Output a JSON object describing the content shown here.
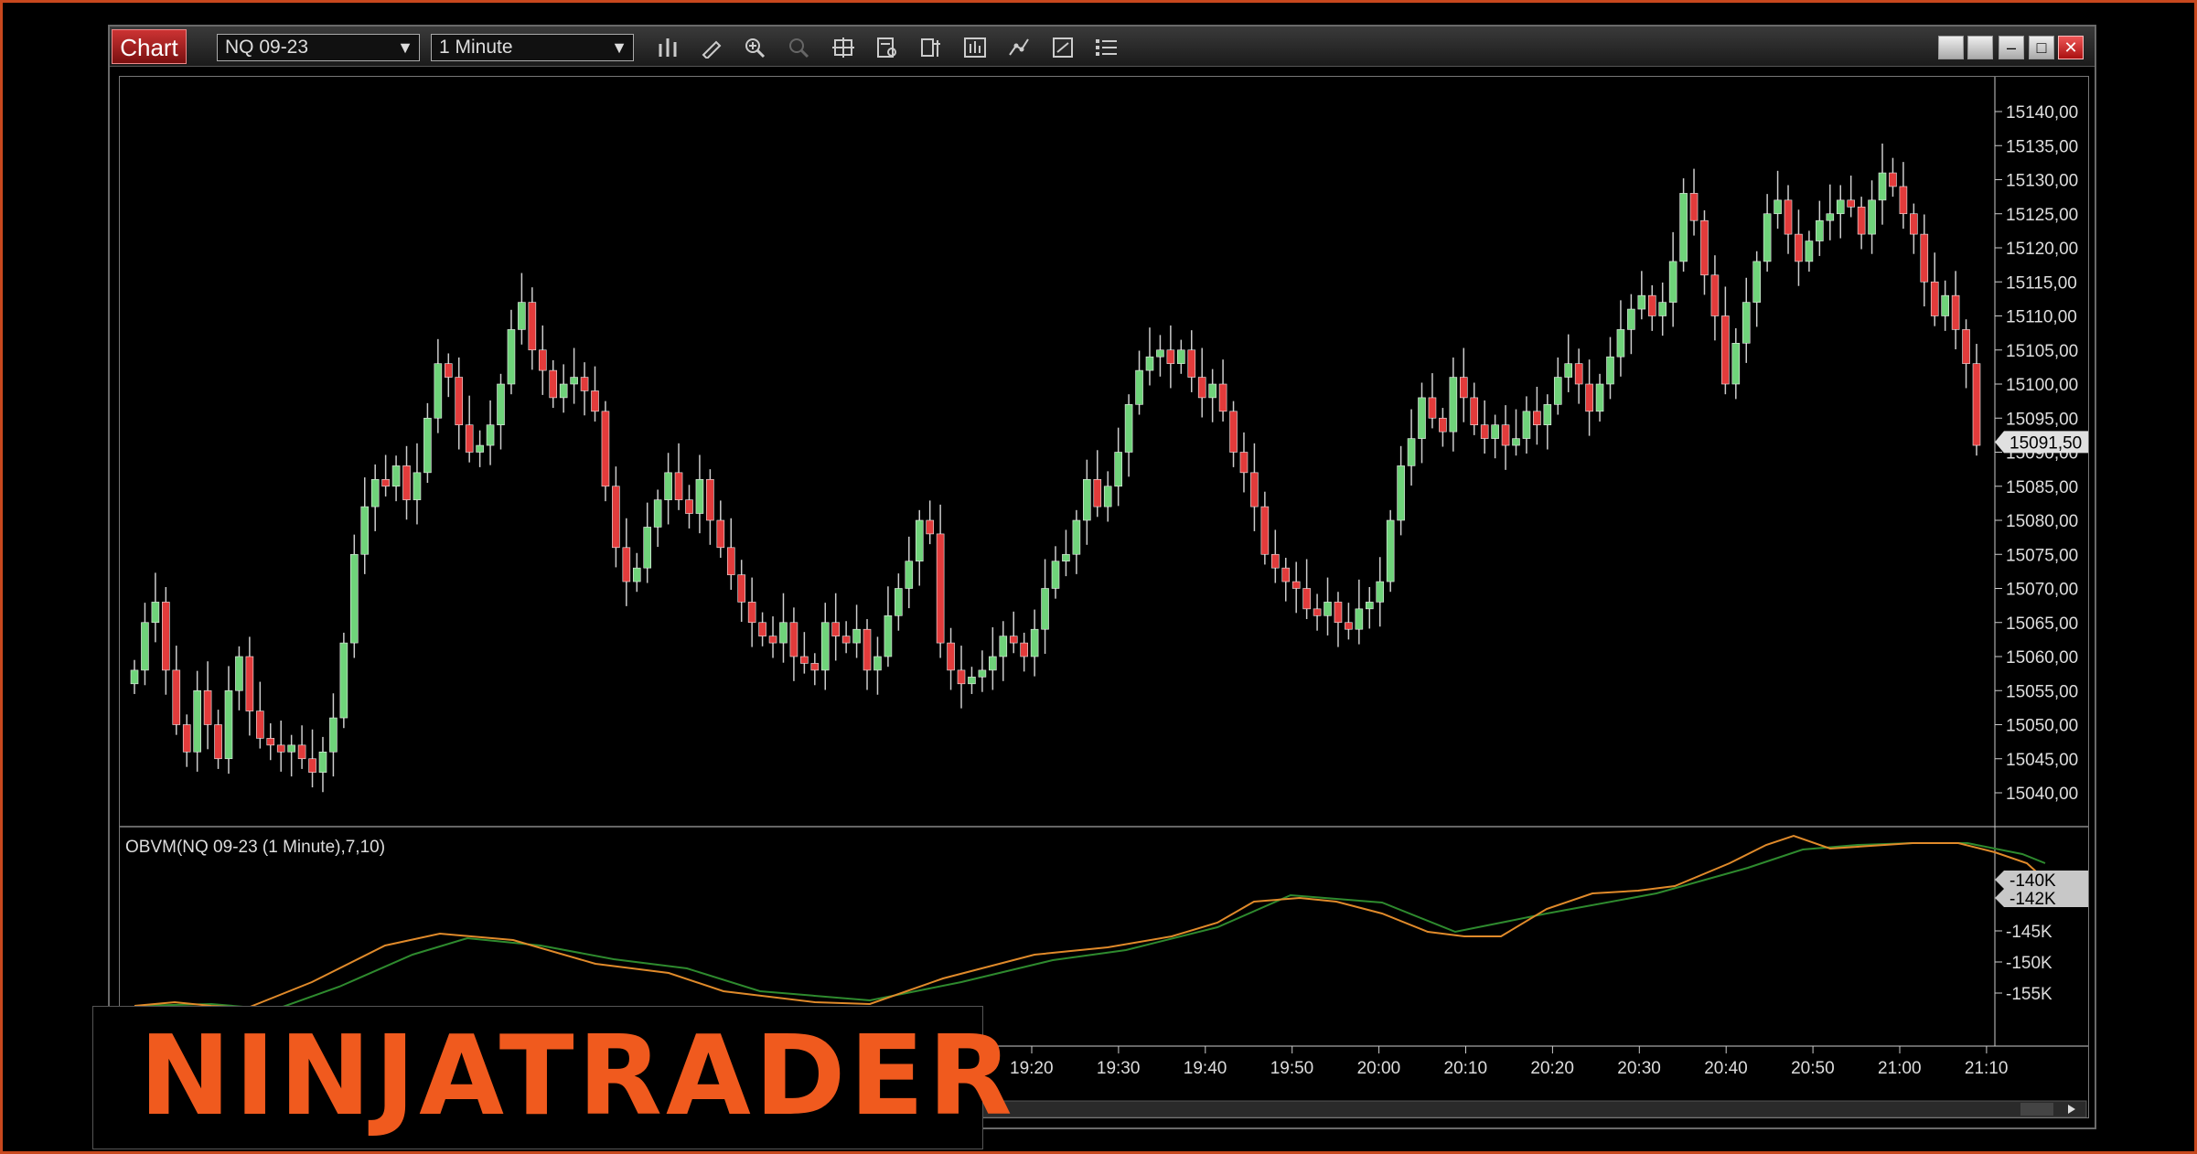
{
  "window": {
    "tab_label": "Chart",
    "instrument": "NQ 09-23",
    "interval": "1 Minute",
    "toolbar_icons": [
      "bar-type-icon",
      "pencil-draw-icon",
      "zoom-in-icon",
      "zoom-out-icon",
      "crosshair-icon",
      "data-box-icon",
      "chart-trader-icon",
      "indicators-icon",
      "strategies-icon",
      "templates-icon",
      "properties-icon"
    ],
    "window_controls": [
      "tile-icon",
      "link-icon",
      "minimize-icon",
      "maximize-icon",
      "close-icon"
    ]
  },
  "price_axis": {
    "labels": [
      "15140,00",
      "15135,00",
      "15130,00",
      "15125,00",
      "15120,00",
      "15115,00",
      "15110,00",
      "15105,00",
      "15100,00",
      "15095,00",
      "15090,00",
      "15085,00",
      "15080,00",
      "15075,00",
      "15070,00",
      "15065,00",
      "15060,00",
      "15055,00",
      "15050,00",
      "15045,00",
      "15040,00"
    ],
    "last_price": "15091,50"
  },
  "indicator": {
    "title": "OBVM(NQ 09-23 (1 Minute),7,10)",
    "axis_labels": [
      "-145K",
      "-150K",
      "-155K"
    ],
    "last_values": [
      "-140K",
      "-142K"
    ],
    "colors": {
      "fast": "#e08a2a",
      "slow": "#2e8a2e"
    }
  },
  "time_axis": {
    "labels": [
      "19:20",
      "19:30",
      "19:40",
      "19:50",
      "20:00",
      "20:10",
      "20:20",
      "20:30",
      "20:40",
      "20:50",
      "21:00",
      "21:10"
    ]
  },
  "logo_text": "NINJATRADER",
  "chart_data": {
    "type": "candlestick",
    "up_color": "#6fd37a",
    "down_color": "#e23b3b",
    "ylim": [
      15036,
      15142
    ],
    "closes": [
      15058,
      15065,
      15068,
      15058,
      15050,
      15046,
      15055,
      15050,
      15045,
      15055,
      15060,
      15052,
      15048,
      15047,
      15046,
      15047,
      15045,
      15043,
      15046,
      15051,
      15062,
      15075,
      15082,
      15086,
      15085,
      15088,
      15083,
      15087,
      15095,
      15103,
      15101,
      15094,
      15090,
      15091,
      15094,
      15100,
      15108,
      15112,
      15105,
      15102,
      15098,
      15100,
      15101,
      15099,
      15096,
      15085,
      15076,
      15071,
      15073,
      15079,
      15083,
      15087,
      15083,
      15081,
      15086,
      15080,
      15076,
      15072,
      15068,
      15065,
      15063,
      15062,
      15065,
      15060,
      15059,
      15058,
      15065,
      15063,
      15062,
      15064,
      15058,
      15060,
      15066,
      15070,
      15074,
      15080,
      15078,
      15062,
      15058,
      15056,
      15057,
      15058,
      15060,
      15063,
      15062,
      15060,
      15064,
      15070,
      15074,
      15075,
      15080,
      15086,
      15082,
      15085,
      15090,
      15097,
      15102,
      15104,
      15105,
      15103,
      15105,
      15101,
      15098,
      15100,
      15096,
      15090,
      15087,
      15082,
      15075,
      15073,
      15071,
      15070,
      15067,
      15066,
      15068,
      15065,
      15064,
      15067,
      15068,
      15071,
      15080,
      15088,
      15092,
      15098,
      15095,
      15093,
      15101,
      15098,
      15094,
      15092,
      15094,
      15091,
      15092,
      15096,
      15094,
      15097,
      15101,
      15103,
      15100,
      15096,
      15100,
      15104,
      15108,
      15111,
      15113,
      15110,
      15112,
      15118,
      15128,
      15124,
      15116,
      15110,
      15100,
      15106,
      15112,
      15118,
      15125,
      15127,
      15122,
      15118,
      15121,
      15124,
      15125,
      15127,
      15126,
      15122,
      15127,
      15131,
      15129,
      15125,
      15122,
      15115,
      15110,
      15113,
      15108,
      15103,
      15091
    ]
  }
}
